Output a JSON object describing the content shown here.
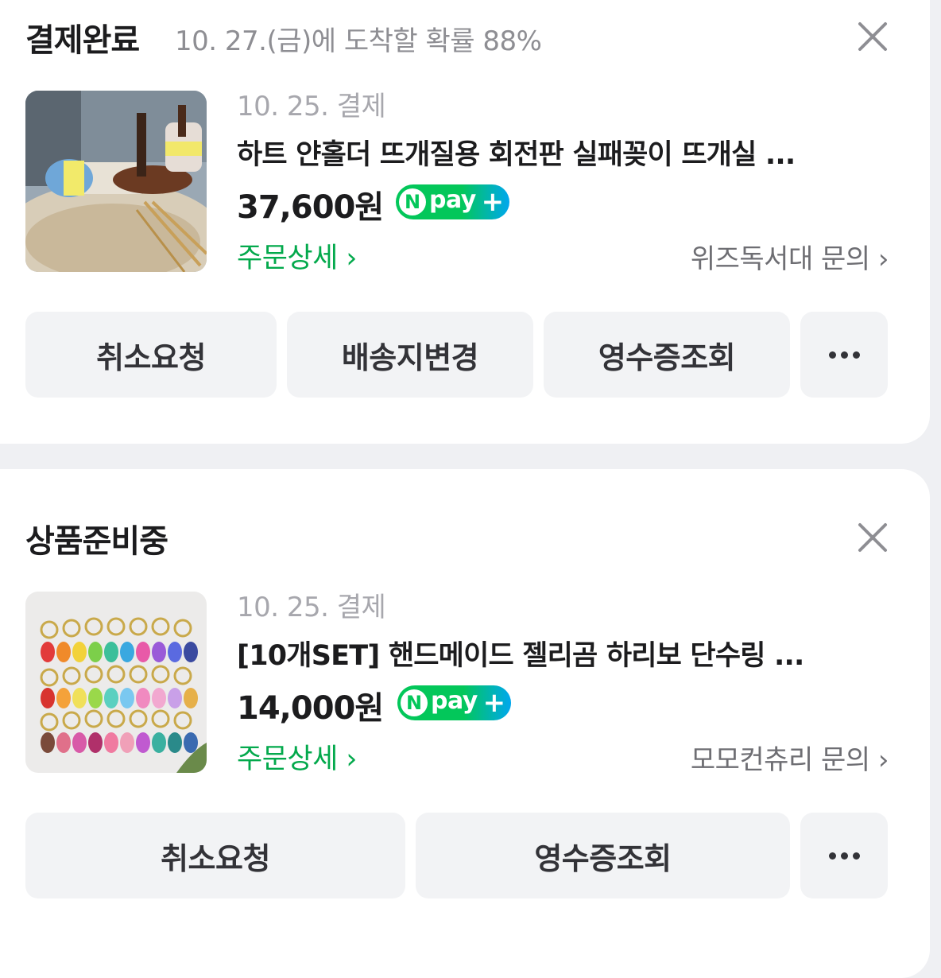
{
  "orders": [
    {
      "status": "결제완료",
      "arrival": "10. 27.(금)에 도착할 확률 88%",
      "pay_date": "10. 25. 결제",
      "title": "하트 얀홀더 뜨개질용 회전판 실패꽂이 뜨개실 ...",
      "price": "37,600원",
      "detail_label": "주문상세 ›",
      "inquiry_label": "위즈독서대 문의 ›",
      "buttons": [
        "취소요청",
        "배송지변경",
        "영수증조회"
      ],
      "thumbnail": "yarn-holder-product-photo"
    },
    {
      "status": "상품준비중",
      "arrival": "",
      "pay_date": "10. 25. 결제",
      "title": "[10개SET] 핸드메이드 젤리곰 하리보 단수링 ...",
      "price": "14,000원",
      "detail_label": "주문상세 ›",
      "inquiry_label": "모모컨츄리 문의 ›",
      "buttons": [
        "취소요청",
        "영수증조회"
      ],
      "thumbnail": "gummy-bear-stitch-markers-photo"
    }
  ],
  "npay": {
    "n": "N",
    "text": "pay",
    "plus": "+"
  },
  "icons": {
    "close": "close-icon",
    "more": "more-icon"
  },
  "colors": {
    "accent_green": "#03a94c",
    "npay_green": "#03c75a",
    "npay_blue": "#00a7ee",
    "button_bg": "#f2f3f5"
  }
}
